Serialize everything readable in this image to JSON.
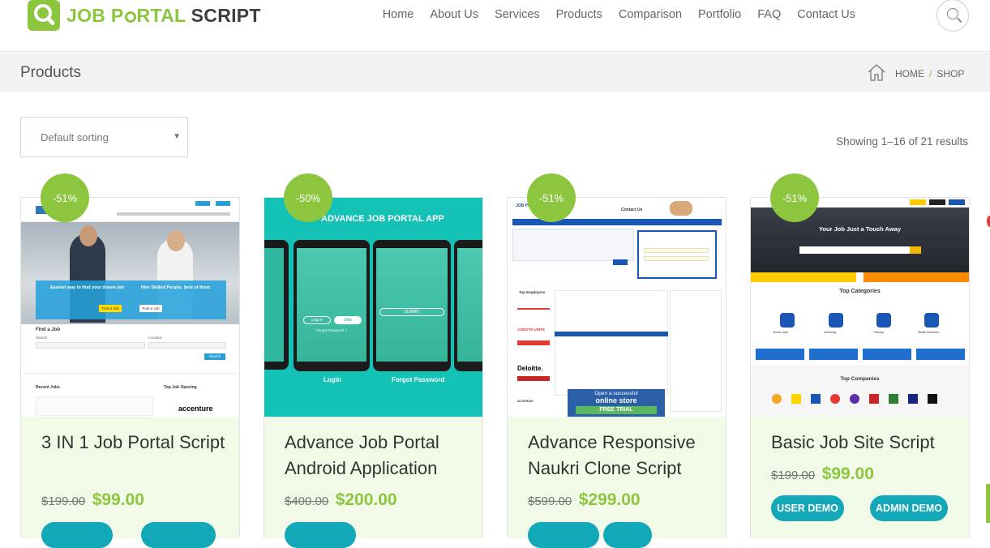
{
  "header": {
    "logo_text_part1": "JOB P",
    "logo_text_part2": "RTAL",
    "logo_text_part3": "SCRIPT",
    "nav": [
      "Home",
      "About Us",
      "Services",
      "Products",
      "Comparison",
      "Portfolio",
      "FAQ",
      "Contact Us"
    ]
  },
  "titlebar": {
    "title": "Products",
    "breadcrumb": [
      "HOME",
      "/",
      "SHOP"
    ]
  },
  "toolbar": {
    "sorting": "Default sorting",
    "results": "Showing 1–16 of 21 results"
  },
  "products": [
    {
      "badge": "-51%",
      "name": "3 IN 1 Job Portal Script",
      "old_price": "$199.00",
      "new_price": "$99.00",
      "thumb": {
        "hero_left": "Easiest way to find your dream job",
        "hero_right": "Hire Skilled People, best of them",
        "find_job_btn": "Find a Job",
        "post_job_btn": "Post a Job",
        "find_heading": "Find a Job",
        "search_label": "Search",
        "location_label": "Location",
        "search_btn": "Search",
        "recent_jobs": "Recent Jobs",
        "top_opening": "Top Job Opening",
        "company": "accenture"
      }
    },
    {
      "badge": "-50%",
      "name": "Advance Job Portal Android Application",
      "old_price": "$400.00",
      "new_price": "$200.00",
      "thumb": {
        "title": "ADVANCE JOB PORTAL APP",
        "login_btn": "Log in",
        "skip_btn": "Skip",
        "forgot": "Forgot Password ?",
        "submit_btn": "SUBMIT",
        "label_login": "Login",
        "label_forgot": "Forgot Password"
      }
    },
    {
      "badge": "-51%",
      "name": "Advance Responsive Naukri Clone Script",
      "old_price": "$599.00",
      "new_price": "$299.00",
      "thumb": {
        "brand": "JOB PORTAL SCRIPT",
        "contact": "Contact Us",
        "employers": "Top Employers",
        "brands": [
          "JOBSITE UNITE",
          "Deloitte.",
          "accenture"
        ],
        "store_line1": "Open a successful",
        "store_line2": "online store",
        "store_line3": "FREE TRIAL"
      }
    },
    {
      "badge": "-51%",
      "name": "Basic Job Site Script",
      "old_price": "$199.00",
      "new_price": "$99.00",
      "buttons": [
        "USER DEMO",
        "ADMIN DEMO"
      ],
      "thumb": {
        "hero": "Your Job Just a Touch Away",
        "categories": "Top Categories",
        "cat_labels": [
          "Books Jobs",
          "University",
          "Training",
          "Health Research"
        ],
        "companies": "Top Companies"
      }
    }
  ],
  "colors": {
    "accent": "#8cc63f",
    "demo_button": "#13a8b8",
    "card_bg": "#f1fae7"
  }
}
